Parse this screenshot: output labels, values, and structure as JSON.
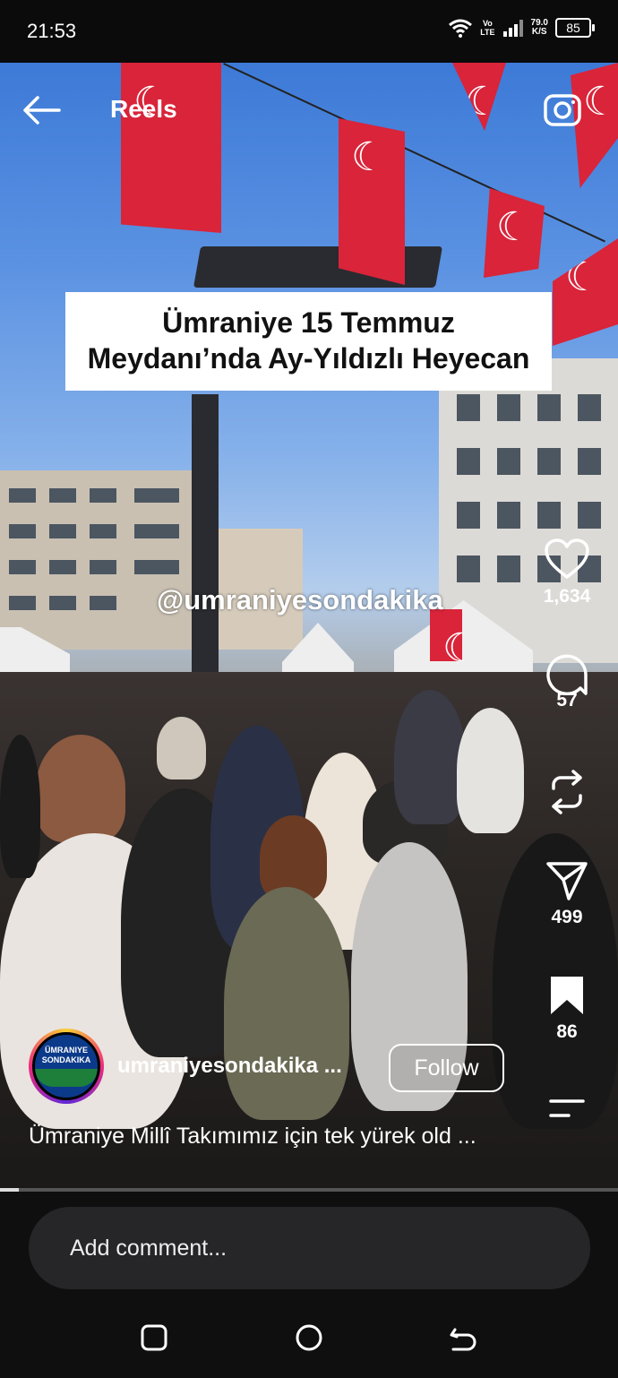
{
  "status_bar": {
    "time": "21:53",
    "network_top": "Vo",
    "network_bottom": "LTE",
    "speed_value": "79.0",
    "speed_unit": "K/S",
    "battery": "85"
  },
  "header": {
    "title": "Reels",
    "back_icon": "back-arrow-icon",
    "camera_icon": "camera-icon"
  },
  "video": {
    "overlay_title_line1": "Ümraniye 15 Temmuz",
    "overlay_title_line2": "Meydanı’nda Ay-Yıldızlı Heyecan",
    "watermark": "@umraniyesondakika"
  },
  "actions": {
    "likes": "1,634",
    "comments": "57",
    "shares": "499",
    "saves": "86"
  },
  "author": {
    "username": "umraniyesondakika ...",
    "avatar_line1": "ÜMRANIYE",
    "avatar_line2": "SONDAKIKA",
    "follow_label": "Follow"
  },
  "post": {
    "caption": "Ümraniye Millî Takımımız için tek yürek old ...",
    "progress_fraction": 0.03
  },
  "comment_bar": {
    "placeholder": "Add comment..."
  },
  "colors": {
    "flag_red": "#d9243a",
    "background": "#000000"
  }
}
